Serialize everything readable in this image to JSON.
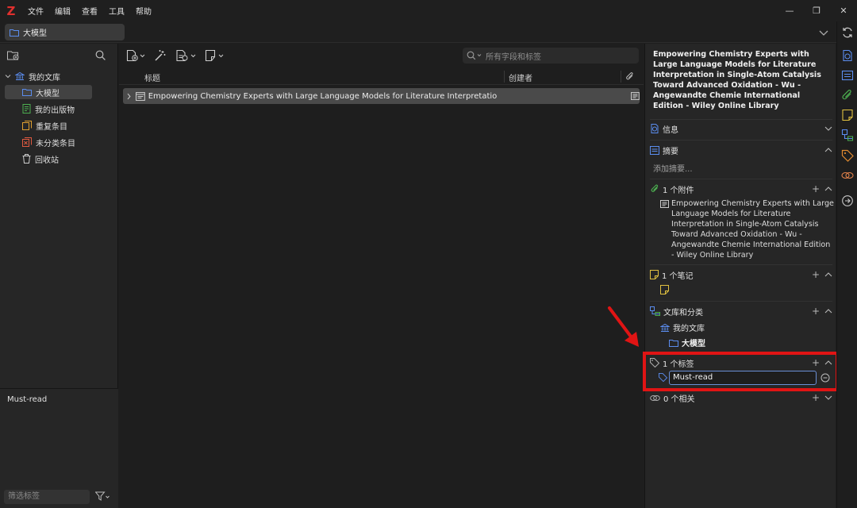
{
  "app": {
    "logo": "Z",
    "menu": [
      "文件",
      "编辑",
      "查看",
      "工具",
      "帮助"
    ]
  },
  "window_controls": {
    "minimize": "—",
    "restore": "❐",
    "close": "✕"
  },
  "tab": {
    "label": "大模型"
  },
  "library_tree": {
    "root": "我的文库",
    "items": [
      {
        "label": "大模型",
        "selected": true
      },
      {
        "label": "我的出版物"
      },
      {
        "label": "重复条目"
      },
      {
        "label": "未分类条目"
      },
      {
        "label": "回收站"
      }
    ]
  },
  "tag_selector": {
    "tags": [
      "Must-read"
    ],
    "filter_placeholder": "筛选标签"
  },
  "items_pane": {
    "search_placeholder": "所有字段和标签",
    "columns": {
      "title": "标题",
      "creator": "创建者"
    },
    "rows": [
      {
        "title": "Empowering Chemistry Experts with Large Language Models for Literature Interpretation in Si...",
        "creator": ""
      }
    ]
  },
  "item_pane": {
    "title": "Empowering Chemistry Experts with Large Language Models for Literature Interpretation in Single-Atom Catalysis Toward Advanced Oxidation - Wu - Angewandte Chemie International Edition - Wiley Online Library",
    "sections": {
      "info": "信息",
      "abstract": "摘要",
      "abstract_placeholder": "添加摘要...",
      "attachments": "1 个附件",
      "attachment_title": "Empowering Chemistry Experts with Large Language Models for Literature Interpretation in Single-Atom Catalysis Toward Advanced Oxidation - Wu - Angewandte Chemie International Edition - Wiley Online Library",
      "notes": "1 个笔记",
      "libraries": "文库和分类",
      "library_name": "我的文库",
      "collection_name": "大模型",
      "tags": "1 个标签",
      "tag_value": "Must-read",
      "related": "0 个相关"
    }
  },
  "colors": {
    "accent_blue": "#5b8def",
    "highlight_red": "#e01414",
    "logo_red": "#e0302e"
  }
}
